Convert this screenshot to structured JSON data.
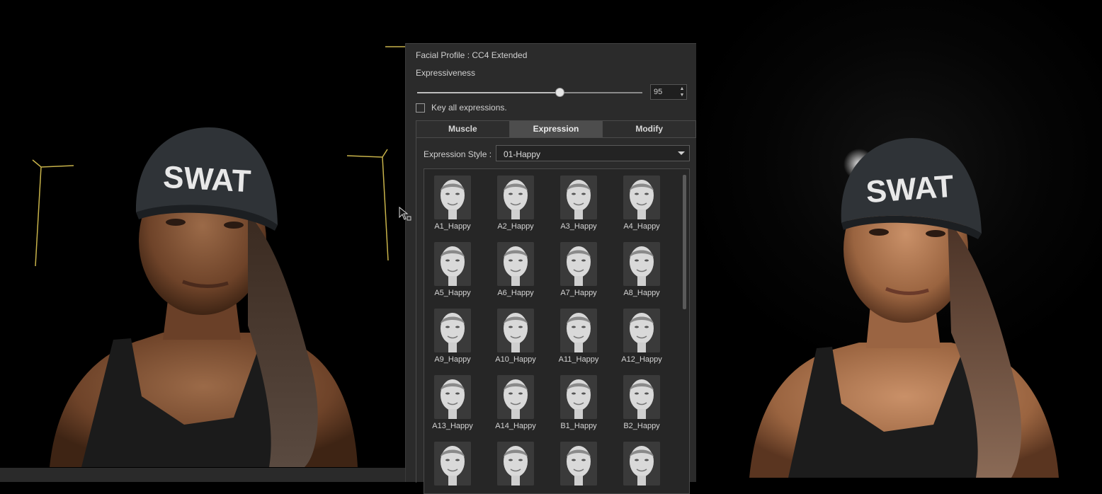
{
  "panel": {
    "facial_profile_label": "Facial Profile : CC4 Extended",
    "expressiveness_label": "Expressiveness",
    "expressiveness_value": 95,
    "expressiveness_value_text": "95",
    "key_all_label": "Key all expressions.",
    "key_all_checked": false,
    "tabs": [
      {
        "label": "Muscle",
        "active": false
      },
      {
        "label": "Expression",
        "active": true
      },
      {
        "label": "Modify",
        "active": false
      }
    ],
    "expression_style_label": "Expression Style :",
    "expression_style_value": "01-Happy",
    "expressions": [
      "A1_Happy",
      "A2_Happy",
      "A3_Happy",
      "A4_Happy",
      "A5_Happy",
      "A6_Happy",
      "A7_Happy",
      "A8_Happy",
      "A9_Happy",
      "A10_Happy",
      "A11_Happy",
      "A12_Happy",
      "A13_Happy",
      "A14_Happy",
      "B1_Happy",
      "B2_Happy"
    ]
  },
  "viewport_left": {
    "cap_text": "SWAT"
  },
  "viewport_right": {
    "cap_text": "SWAT"
  },
  "colors": {
    "panel_bg": "#2b2b2b",
    "tab_active": "#4d4d4d",
    "bone_lines": "#c8b34a",
    "skin": "#8a5a3b",
    "cap": "#2f3337"
  }
}
